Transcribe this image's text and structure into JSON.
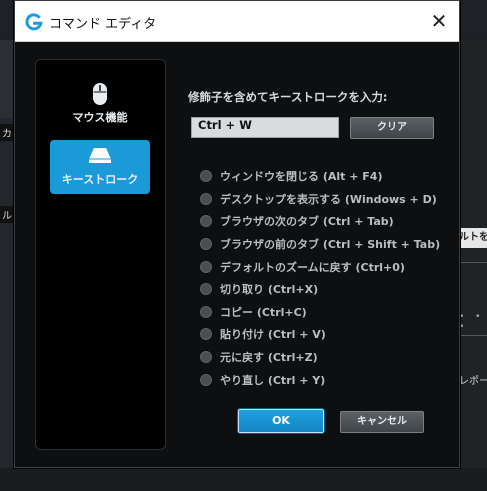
{
  "window": {
    "title": "コマンド エディタ"
  },
  "background": {
    "left_labels": [
      "カン",
      "ル"
    ],
    "right_button": "ルトを含",
    "right_dots": "• • •",
    "right_label": "レポー"
  },
  "sidebar": {
    "items": [
      {
        "label": "マウス機能",
        "icon": "mouse-icon",
        "selected": false
      },
      {
        "label": "キーストローク",
        "icon": "keycap-icon",
        "selected": true
      }
    ]
  },
  "keystroke": {
    "prompt": "修飾子を含めてキーストロークを入力:",
    "value": "Ctrl + W",
    "clear_label": "クリア"
  },
  "shortcuts": [
    "ウィンドウを閉じる (Alt + F4)",
    "デスクトップを表示する (Windows + D)",
    "ブラウザの次のタブ (Ctrl + Tab)",
    "ブラウザの前のタブ (Ctrl + Shift + Tab)",
    "デフォルトのズームに戻す (Ctrl+0)",
    "切り取り (Ctrl+X)",
    "コピー (Ctrl+C)",
    "貼り付け (Ctrl + V)",
    "元に戻す (Ctrl+Z)",
    "やり直し (Ctrl + Y)"
  ],
  "buttons": {
    "ok": "OK",
    "cancel": "キャンセル"
  },
  "colors": {
    "accent": "#1b9ad8",
    "logo": "#1e9be0"
  }
}
